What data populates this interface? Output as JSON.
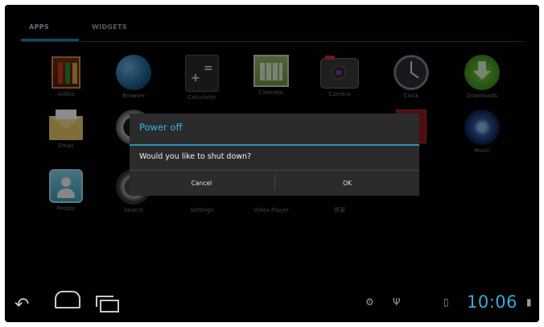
{
  "tabs": {
    "apps": "APPS",
    "widgets": "WIDGETS"
  },
  "apps": [
    {
      "label": "Aldiko",
      "icon": "aldiko-books-icon"
    },
    {
      "label": "Browser",
      "icon": "browser-globe-icon"
    },
    {
      "label": "Calculator",
      "icon": "calculator-icon"
    },
    {
      "label": "Calendar",
      "icon": "calendar-icon"
    },
    {
      "label": "Camera",
      "icon": "camera-icon"
    },
    {
      "label": "Clock",
      "icon": "clock-icon"
    },
    {
      "label": "Downloads",
      "icon": "downloads-icon"
    },
    {
      "label": "Email",
      "icon": "email-icon"
    },
    {
      "label": "Music",
      "icon": "music-icon"
    },
    {
      "label": "People",
      "icon": "people-icon"
    },
    {
      "label": "Search",
      "icon": "search-icon"
    },
    {
      "label": "Settings",
      "icon": "settings-icon"
    },
    {
      "label": "Video Player",
      "icon": "video-player-icon"
    },
    {
      "label": "资源",
      "icon": "resource-app-icon"
    }
  ],
  "dialog": {
    "title": "Power off",
    "message": "Would you like to shut down?",
    "cancel": "Cancel",
    "ok": "OK"
  },
  "navbar": {
    "time": "10:06",
    "icons": [
      "back-icon",
      "home-icon",
      "recent-apps-icon",
      "debug-icon",
      "usb-icon",
      "sd-card-icon",
      "user-icon"
    ]
  },
  "colors": {
    "accent": "#35b5e5",
    "clock": "#3aa9d9",
    "background": "#030303",
    "dialog": "#2b2b2b"
  }
}
